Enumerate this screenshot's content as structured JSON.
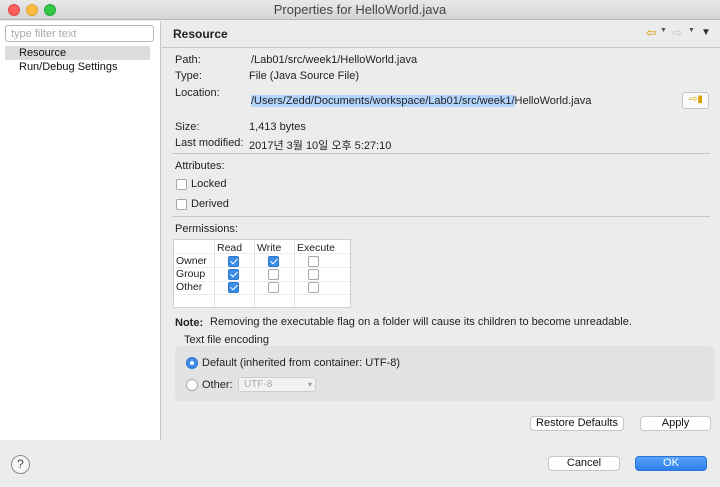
{
  "window": {
    "title": "Properties for HelloWorld.java"
  },
  "sidebar": {
    "filter_placeholder": "type filter text",
    "items": [
      {
        "label": "Resource",
        "selected": true
      },
      {
        "label": "Run/Debug Settings",
        "selected": false
      }
    ]
  },
  "page": {
    "title": "Resource",
    "nav_back_icon": "arrow-left-icon",
    "nav_forward_icon": "arrow-right-icon",
    "nav_menu_icon": "menu-triangle-icon"
  },
  "info": {
    "path_label": "Path:",
    "path_value": "/Lab01/src/week1/HelloWorld.java",
    "type_label": "Type:",
    "type_value": "File  (Java Source File)",
    "location_label": "Location:",
    "location_selected": "/Users/Zedd/Documents/workspace/Lab01/src/week1/",
    "location_rest": "HelloWorld.java",
    "size_label": "Size:",
    "size_value": "1,413  bytes",
    "modified_label": "Last modified:",
    "modified_value": "2017년 3월 10일 오후 5:27:10"
  },
  "attributes": {
    "title": "Attributes:",
    "locked_label": "Locked",
    "locked": false,
    "derived_label": "Derived",
    "derived": false
  },
  "permissions": {
    "title": "Permissions:",
    "columns": [
      "Read",
      "Write",
      "Execute"
    ],
    "rows": [
      {
        "label": "Owner",
        "read": true,
        "write": true,
        "execute": false
      },
      {
        "label": "Group",
        "read": true,
        "write": false,
        "execute": false
      },
      {
        "label": "Other",
        "read": true,
        "write": false,
        "execute": false
      }
    ]
  },
  "note": {
    "label": "Note:",
    "text": "Removing the executable flag on a folder will cause its children to become unreadable."
  },
  "encoding": {
    "title": "Text file encoding",
    "default_label": "Default (inherited from container: UTF-8)",
    "other_label": "Other:",
    "other_value": "UTF-8",
    "selected": "default"
  },
  "buttons": {
    "restore_defaults": "Restore Defaults",
    "apply": "Apply",
    "cancel": "Cancel",
    "ok": "OK",
    "help": "?"
  },
  "colors": {
    "accent": "#2b80f0",
    "selection": "#b3d4fc"
  }
}
